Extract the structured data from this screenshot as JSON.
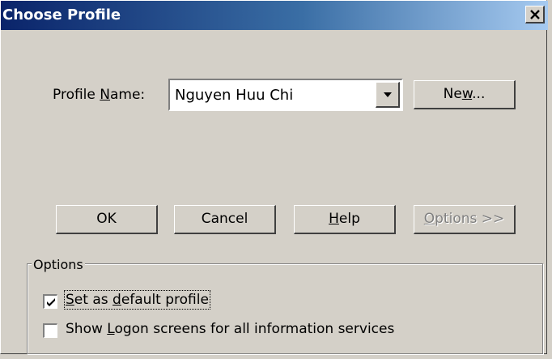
{
  "window": {
    "title": "Choose Profile",
    "close_glyph": "✕"
  },
  "profile": {
    "label_pre": "Profile ",
    "label_accel": "N",
    "label_post": "ame:",
    "selected": "Nguyen Huu Chi"
  },
  "buttons": {
    "new_pre": "Ne",
    "new_accel": "w",
    "new_post": "...",
    "ok": "OK",
    "cancel": "Cancel",
    "help_accel": "H",
    "help_post": "elp",
    "options_accel": "O",
    "options_post": "ptions >>"
  },
  "options_group": {
    "title": "Options",
    "default_profile": {
      "accel1": "S",
      "part1": "et as ",
      "accel2": "d",
      "part2": "efault profile",
      "checked": true
    },
    "show_logon": {
      "part1": "Show ",
      "accel": "L",
      "part2": "ogon screens for all information services",
      "checked": false
    }
  },
  "icons": {
    "close": "close-icon",
    "dropdown": "dropdown-arrow-icon",
    "check": "checkmark-icon"
  }
}
